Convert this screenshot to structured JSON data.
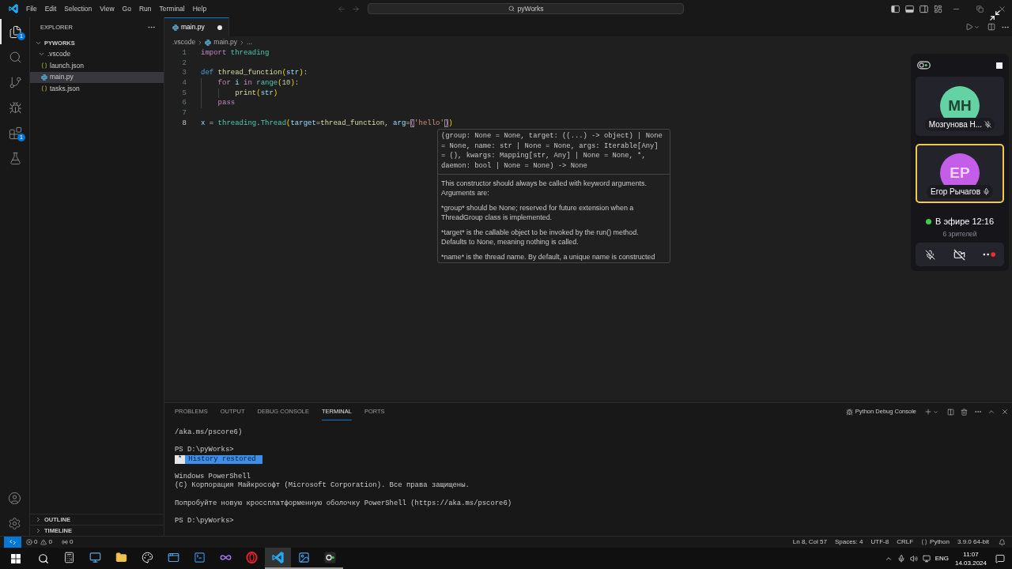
{
  "title_bar": {
    "menus": [
      "File",
      "Edit",
      "Selection",
      "View",
      "Go",
      "Run",
      "Terminal",
      "Help"
    ],
    "search": {
      "value": "pyWorks"
    },
    "layout_toggles": [
      {
        "on": true
      },
      {
        "on": true
      },
      {
        "on": false
      }
    ]
  },
  "activity_bar": {
    "items": [
      {
        "selected": true,
        "badge": "1"
      },
      {
        "selected": false
      },
      {
        "selected": false
      },
      {
        "selected": false
      },
      {
        "selected": false,
        "badge": "1"
      },
      {
        "selected": false
      }
    ]
  },
  "sidebar": {
    "title": "EXPLORER",
    "tree": [
      {
        "label": "PYWORKS",
        "kind": "workspace",
        "expanded": true,
        "children": [
          {
            "label": ".vscode",
            "kind": "folder",
            "expanded": true,
            "selected": false,
            "children": [
              {
                "label": "launch.json",
                "kind": "json",
                "selected": false
              },
              {
                "label": "main.py",
                "kind": "python",
                "selected": true
              },
              {
                "label": "tasks.json",
                "kind": "json",
                "selected": false
              }
            ]
          }
        ]
      }
    ],
    "sections": [
      {
        "label": "OUTLINE",
        "expanded": false
      },
      {
        "label": "TIMELINE",
        "expanded": false
      }
    ]
  },
  "editor": {
    "tabs": [
      {
        "label": "main.py",
        "kind": "python",
        "selected": true,
        "modified": true
      }
    ],
    "breadcrumbs": [
      {
        "label": ".vscode",
        "kind": "folder"
      },
      {
        "label": "main.py",
        "kind": "python"
      },
      {
        "label": "...",
        "kind": "more"
      }
    ],
    "lines": [
      {
        "number": "1",
        "current": false,
        "tokens": [
          {
            "text": "import",
            "kind": "keyword"
          },
          {
            "text": " threading",
            "kind": "type"
          }
        ]
      },
      {
        "number": "2",
        "current": false
      },
      {
        "number": "3",
        "current": false,
        "tokens": [
          {
            "text": "def",
            "kind": "storage"
          },
          {
            "text": " thread_function",
            "kind": "function"
          },
          {
            "text": "(",
            "kind": "bracket"
          },
          {
            "text": "str",
            "kind": "variable"
          },
          {
            "text": ")",
            "kind": "bracket"
          },
          {
            "text": ":",
            "kind": "punct"
          }
        ]
      },
      {
        "number": "4",
        "current": false,
        "tokens": [
          {
            "text": "    for",
            "kind": "keyword"
          },
          {
            "text": " i",
            "kind": "variable"
          },
          {
            "text": " in",
            "kind": "keyword"
          },
          {
            "text": " range",
            "kind": "type"
          },
          {
            "text": "(",
            "kind": "bracket"
          },
          {
            "text": "10",
            "kind": "number"
          },
          {
            "text": ")",
            "kind": "bracket"
          },
          {
            "text": ":",
            "kind": "punct"
          }
        ]
      },
      {
        "number": "5",
        "current": false,
        "tokens": [
          {
            "text": "        print",
            "kind": "function"
          },
          {
            "text": "(",
            "kind": "bracket"
          },
          {
            "text": "str",
            "kind": "variable"
          },
          {
            "text": ")",
            "kind": "bracket"
          }
        ]
      },
      {
        "number": "6",
        "current": false,
        "tokens": [
          {
            "text": "    pass",
            "kind": "keyword"
          }
        ]
      },
      {
        "number": "7",
        "current": false
      },
      {
        "number": "8",
        "current": true,
        "tokens": [
          {
            "text": "x",
            "kind": "variable"
          },
          {
            "text": " = ",
            "kind": "punct"
          },
          {
            "text": "threading",
            "kind": "type"
          },
          {
            "text": ".",
            "kind": "punct"
          },
          {
            "text": "Thread",
            "kind": "type"
          },
          {
            "text": "(",
            "kind": "bracket"
          },
          {
            "text": "target",
            "kind": "variable"
          },
          {
            "text": "=",
            "kind": "punct"
          },
          {
            "text": "thread_function",
            "kind": "function"
          },
          {
            "text": ", ",
            "kind": "punct"
          },
          {
            "text": "arg",
            "kind": "variable"
          },
          {
            "text": "=",
            "kind": "punct"
          },
          {
            "text": "(",
            "kind": "match"
          },
          {
            "text": "'hello'",
            "kind": "string"
          },
          {
            "text": ")",
            "kind": "match"
          },
          {
            "text": ")",
            "kind": "bracket"
          }
        ]
      }
    ],
    "hover": {
      "signature": "(group: None = None, target: ((...) -> object) | None = None, name: str | None = None, args: Iterable[Any] = (), kwargs: Mapping[str, Any] | None = None, *, daemon: bool | None = None) -> None",
      "paragraphs": [
        "This constructor should always be called with keyword arguments. Arguments are:",
        "*group* should be None; reserved for future extension when a ThreadGroup class is implemented.",
        "*target* is the callable object to be invoked by the run() method. Defaults to None, meaning nothing is called.",
        "*name* is the thread name. By default, a unique name is constructed"
      ]
    }
  },
  "panel": {
    "tabs": [
      {
        "label": "PROBLEMS",
        "selected": false
      },
      {
        "label": "OUTPUT",
        "selected": false
      },
      {
        "label": "DEBUG CONSOLE",
        "selected": false
      },
      {
        "label": "TERMINAL",
        "selected": true
      },
      {
        "label": "PORTS",
        "selected": false
      }
    ],
    "terminal_name": "Python Debug Console",
    "terminal": {
      "blocks": [
        {
          "lines": [
            {
              "kind": "text",
              "text": "/aka.ms/pscore6)"
            }
          ]
        },
        {
          "lines": [
            {
              "kind": "text",
              "text": "PS D:\\pyWorks>"
            },
            {
              "kind": "banner",
              "marker": "*",
              "text": "History restored"
            }
          ]
        },
        {
          "lines": [
            {
              "kind": "text",
              "text": "Windows PowerShell"
            },
            {
              "kind": "text",
              "text": "(C) Корпорация Майкрософт (Microsoft Corporation). Все права защищены."
            }
          ]
        },
        {
          "lines": [
            {
              "kind": "text",
              "text": "Попробуйте новую кроссплатформенную оболочку PowerShell (https://aka.ms/pscore6)"
            }
          ]
        },
        {
          "lines": [
            {
              "kind": "text",
              "text": "PS D:\\pyWorks>"
            }
          ]
        }
      ]
    }
  },
  "call_panel": {
    "participants": [
      {
        "initials": "МН",
        "name": "Мозгунова Н...",
        "color": "#63d3a3",
        "muted": true,
        "speaking": false
      },
      {
        "initials": "ЕР",
        "name": "Егор Рычагов",
        "color": "#c45ee8",
        "muted": false,
        "speaking": true
      }
    ],
    "live": "В эфире 12:16",
    "viewers": "6 зрителей",
    "controls": {
      "mic_on": false,
      "camera_on": false
    }
  },
  "status_bar": {
    "errors": "0",
    "warnings": "0",
    "ports": "0",
    "items": [
      {
        "kind": "plain",
        "text": "Ln 8, Col 57"
      },
      {
        "kind": "plain",
        "text": "Spaces: 4"
      },
      {
        "kind": "plain",
        "text": "UTF-8"
      },
      {
        "kind": "plain",
        "text": "CRLF"
      },
      {
        "kind": "language",
        "text": "Python"
      },
      {
        "kind": "plain",
        "text": "3.9.0 64-bit"
      }
    ]
  },
  "taskbar": {
    "apps": [
      {
        "running": false,
        "selected": false
      },
      {
        "running": false,
        "selected": false
      },
      {
        "running": false,
        "selected": false
      },
      {
        "running": false,
        "selected": false
      },
      {
        "running": false,
        "selected": false
      },
      {
        "running": false,
        "selected": false
      },
      {
        "running": false,
        "selected": false
      },
      {
        "running": false,
        "selected": false
      },
      {
        "running": true,
        "selected": true
      },
      {
        "running": true,
        "selected": false
      },
      {
        "running": true,
        "selected": false
      }
    ],
    "language": "ENG",
    "time": "11:07",
    "date": "14.03.2024"
  }
}
